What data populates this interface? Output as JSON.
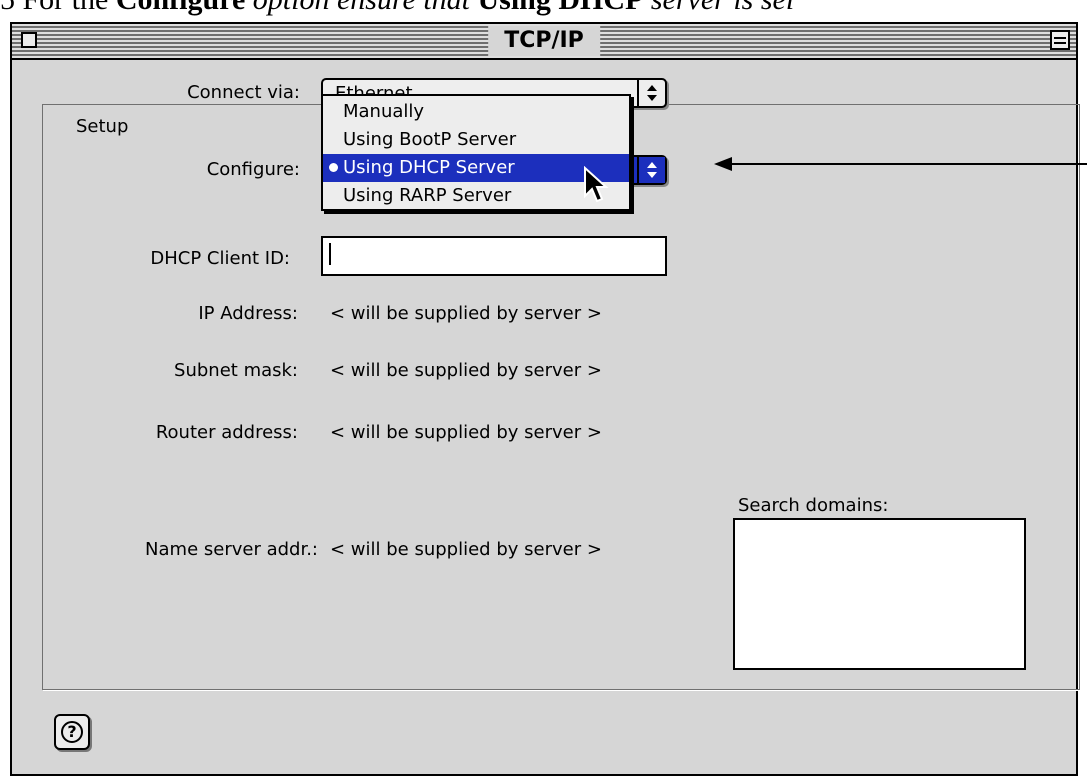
{
  "doc_header": {
    "prefix": "5   For the ",
    "bold1": "Configure",
    "middle": " option ensure that ",
    "bold2": "Using DHCP",
    "suffix": " server is sel"
  },
  "window": {
    "title": "TCP/IP"
  },
  "connect_via": {
    "label": "Connect via:",
    "value": "Ethernet"
  },
  "setup": {
    "title": "Setup",
    "configure_label": "Configure:",
    "configure_value": "Using DHCP Server"
  },
  "configure_menu": {
    "items": [
      {
        "label": "Manually"
      },
      {
        "label": "Using BootP Server"
      },
      {
        "label": "Using DHCP Server",
        "selected": true
      },
      {
        "label": "Using RARP Server"
      }
    ]
  },
  "fields": {
    "dhcp_client_id_label": "DHCP Client ID:",
    "dhcp_client_id_value": "",
    "ip_label": "IP Address:",
    "ip_value": "< will be supplied by server >",
    "subnet_label": "Subnet mask:",
    "subnet_value": "< will be supplied by server >",
    "router_label": "Router address:",
    "router_value": "< will be supplied by server >",
    "name_server_label": "Name server addr.:",
    "name_server_value": "< will be supplied by server >",
    "search_domains_label": "Search domains:",
    "search_domains_value": ""
  },
  "icons": {
    "close": "close-box-icon",
    "zoom": "zoom-box-icon",
    "help": "help-icon",
    "popup_arrows": "up-down-arrows-icon",
    "pointer": "arrow-cursor-icon",
    "annotation": "annotation-arrow-icon"
  },
  "colors": {
    "window_bg": "#d6d6d6",
    "selection": "#1c2fbd"
  }
}
